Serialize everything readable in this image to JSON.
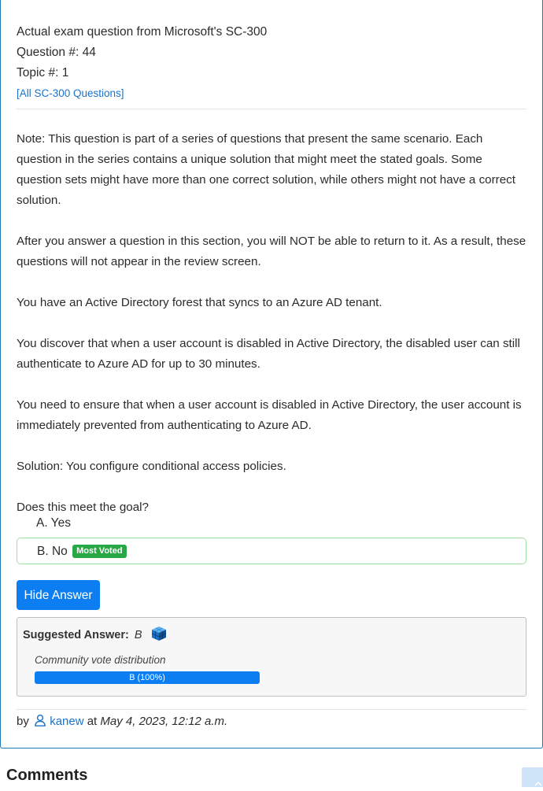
{
  "header": {
    "exam_line": "Actual exam question from Microsoft's SC-300",
    "question_number": "Question #: 44",
    "topic": "Topic #: 1",
    "all_questions_link": "[All SC-300 Questions]"
  },
  "question": {
    "paragraphs": [
      "Note: This question is part of a series of questions that present the same scenario. Each question in the series contains a unique solution that might meet the stated goals. Some question sets might have more than one correct solution, while others might not have a correct solution.",
      "After you answer a question in this section, you will NOT be able to return to it. As a result, these questions will not appear in the review screen.",
      "You have an Active Directory forest that syncs to an Azure AD tenant.",
      "You discover that when a user account is disabled in Active Directory, the disabled user can still authenticate to Azure AD for up to 30 minutes.",
      "You need to ensure that when a user account is disabled in Active Directory, the user account is immediately prevented from authenticating to Azure AD.",
      "Solution: You configure conditional access policies.",
      "Does this meet the goal?"
    ],
    "choices": [
      {
        "label": "A. Yes"
      },
      {
        "label": "B. No",
        "badge": "Most Voted"
      }
    ]
  },
  "answer": {
    "hide_button": "Hide Answer",
    "suggested_label": "Suggested Answer:",
    "suggested_value": "B",
    "cube_icon": "answer-cube-icon",
    "vote_label": "Community vote distribution",
    "vote_bar_text": "B (100%)",
    "vote_fraction": 1.0
  },
  "byline": {
    "by": "by",
    "user_icon": "user-icon",
    "username": "kanew",
    "at": "at",
    "date": "May 4, 2023, 12:12 a.m."
  },
  "comments": {
    "heading": "Comments"
  },
  "colors": {
    "accent_blue": "#0d7ef2",
    "link_blue": "#1a73c9",
    "badge_green": "#28a745",
    "correct_border": "#9fe0a3",
    "card_border": "#1f7ab4"
  }
}
